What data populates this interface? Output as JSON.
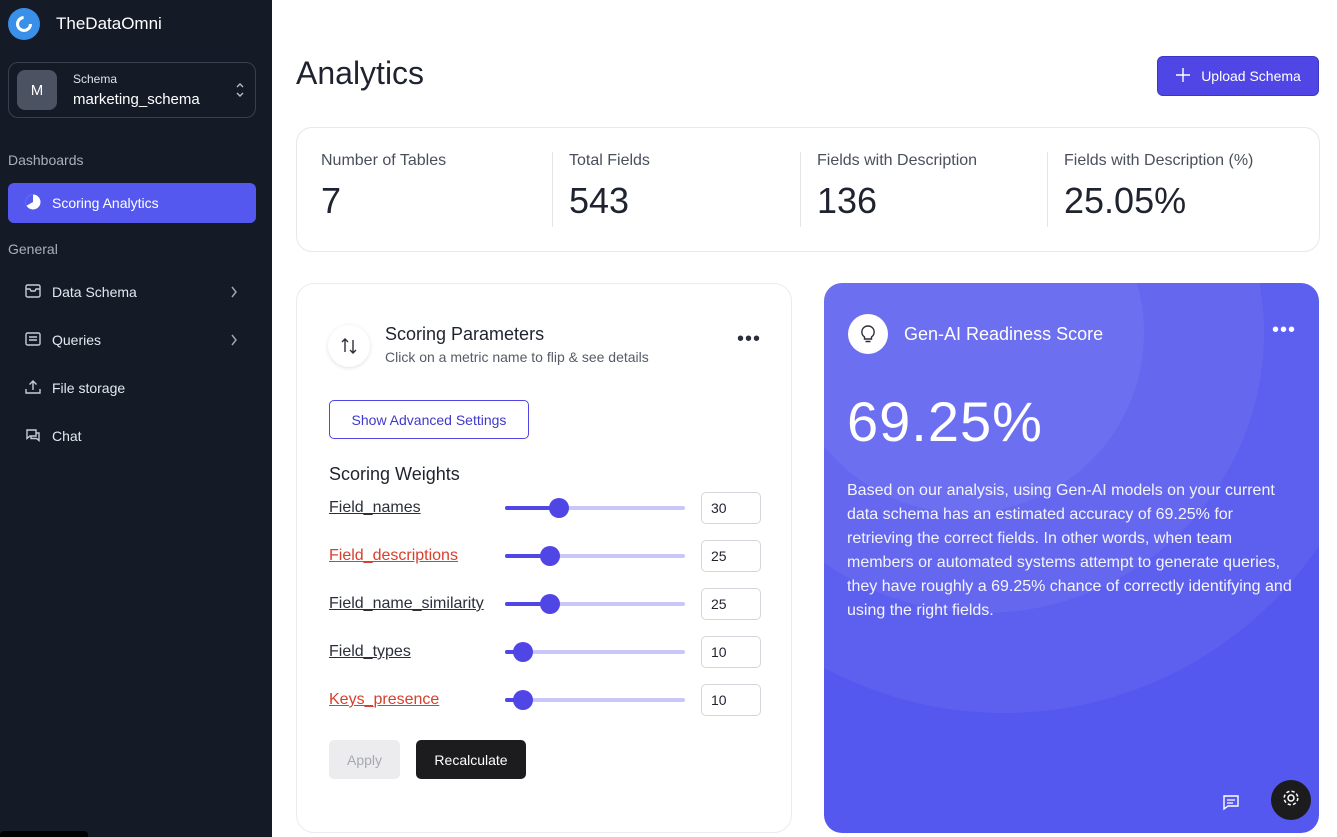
{
  "app": {
    "name": "TheDataOmni"
  },
  "schema_selector": {
    "avatar_letter": "M",
    "label": "Schema",
    "value": "marketing_schema"
  },
  "sidebar": {
    "dashboards_label": "Dashboards",
    "general_label": "General",
    "active_item": {
      "label": "Scoring Analytics",
      "icon": "pie-chart-icon"
    },
    "items": [
      {
        "label": "Data Schema",
        "icon": "inbox-icon",
        "has_chevron": true
      },
      {
        "label": "Queries",
        "icon": "list-icon",
        "has_chevron": true
      },
      {
        "label": "File storage",
        "icon": "upload-icon",
        "has_chevron": false
      },
      {
        "label": "Chat",
        "icon": "chat-icon",
        "has_chevron": false
      }
    ]
  },
  "header": {
    "title": "Analytics",
    "upload_label": "Upload Schema"
  },
  "stats": [
    {
      "label": "Number of Tables",
      "value": "7"
    },
    {
      "label": "Total Fields",
      "value": "543"
    },
    {
      "label": "Fields with Description",
      "value": "136"
    },
    {
      "label": "Fields with Description (%)",
      "value": "25.05%"
    }
  ],
  "scoring": {
    "title": "Scoring Parameters",
    "subtitle": "Click on a metric name to flip & see details",
    "advanced_label": "Show Advanced Settings",
    "weights_title": "Scoring Weights",
    "weights": [
      {
        "name": "Field_names",
        "value": "30",
        "level": 0.3,
        "highlight": false
      },
      {
        "name": "Field_descriptions",
        "value": "25",
        "level": 0.25,
        "highlight": true
      },
      {
        "name": "Field_name_similarity",
        "value": "25",
        "level": 0.25,
        "highlight": false
      },
      {
        "name": "Field_types",
        "value": "10",
        "level": 0.1,
        "highlight": false
      },
      {
        "name": "Keys_presence",
        "value": "10",
        "level": 0.1,
        "highlight": true
      }
    ],
    "apply_label": "Apply",
    "recalculate_label": "Recalculate"
  },
  "genai": {
    "title": "Gen-AI Readiness Score",
    "score": "69.25%",
    "description": "Based on our analysis, using Gen-AI models on your current data schema has an estimated accuracy of 69.25% for retrieving the correct fields. In other words, when team members or automated systems attempt to generate queries, they have roughly a 69.25% chance of correctly identifying and using the right fields."
  },
  "colors": {
    "accent": "#5558ef",
    "sidebar": "#141a26",
    "highlight": "#d6402f"
  }
}
